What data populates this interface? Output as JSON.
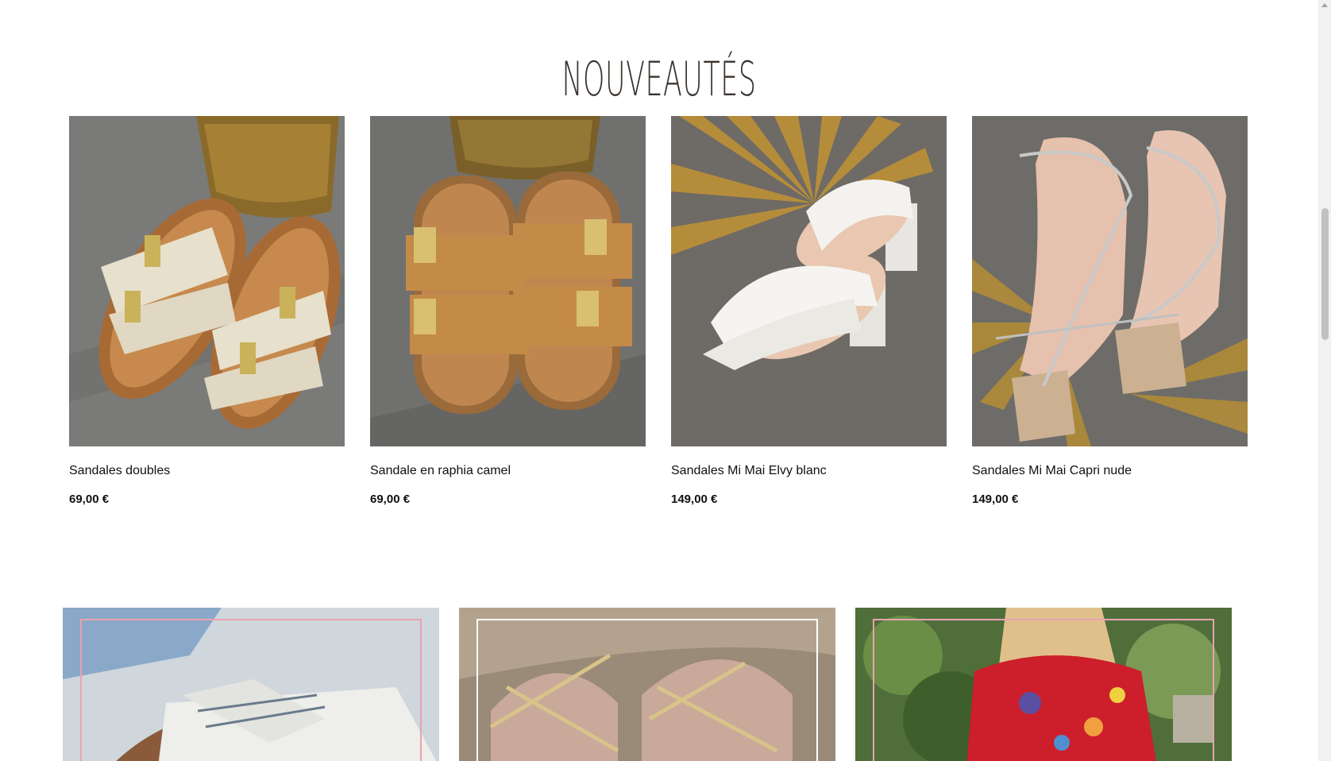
{
  "section": {
    "title": "NOUVEAUTÉS"
  },
  "products": [
    {
      "name": "Sandales doubles",
      "price": "69,00 €",
      "image": "beige-raffia-double-buckle-sandals"
    },
    {
      "name": "Sandale en raphia camel",
      "price": "69,00 €",
      "image": "camel-raffia-double-buckle-sandals"
    },
    {
      "name": "Sandales Mi Mai Elvy blanc",
      "price": "149,00 €",
      "image": "white-block-heel-mules"
    },
    {
      "name": "Sandales Mi Mai Capri nude",
      "price": "149,00 €",
      "image": "nude-strappy-heel-sandals"
    }
  ],
  "banners": [
    {
      "image": "sneakers-photo",
      "frame_color": "#e9a3b0"
    },
    {
      "image": "gold-sandals-photo",
      "frame_color": "#ffffff"
    },
    {
      "image": "red-floral-blouse-photo",
      "frame_color": "#e9a3b0"
    }
  ],
  "colors": {
    "title": "#3a332e",
    "text": "#111111",
    "background": "#ffffff"
  }
}
